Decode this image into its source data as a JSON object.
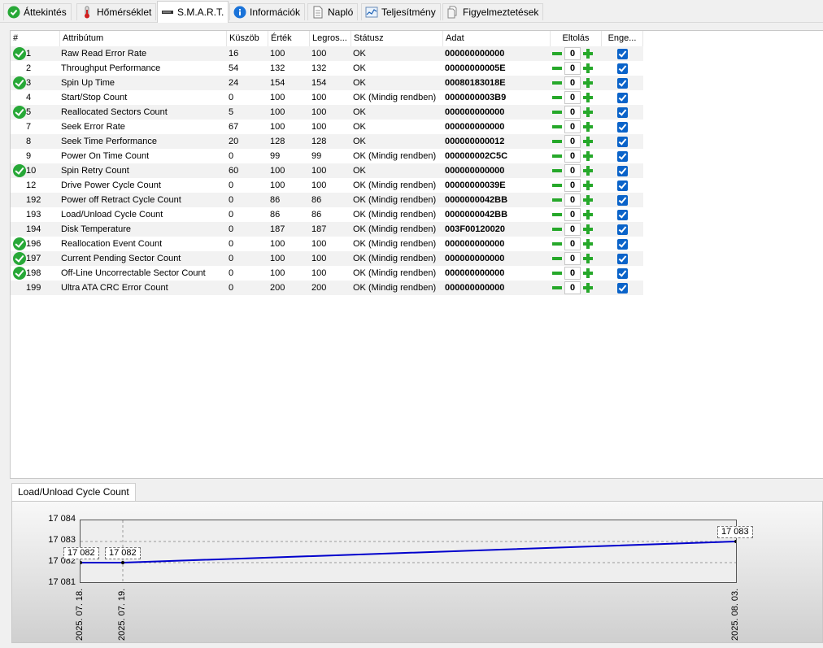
{
  "tabs": [
    {
      "label": "Áttekintés",
      "icon": "check-circle-icon"
    },
    {
      "label": "Hőmérséklet",
      "icon": "thermometer-icon"
    },
    {
      "label": "S.M.A.R.T.",
      "icon": "drive-icon"
    },
    {
      "label": "Információk",
      "icon": "info-icon"
    },
    {
      "label": "Napló",
      "icon": "document-icon"
    },
    {
      "label": "Teljesítmény",
      "icon": "performance-chart-icon"
    },
    {
      "label": "Figyelmeztetések",
      "icon": "warnings-icon"
    }
  ],
  "columns": {
    "id": "#",
    "attr": "Attribútum",
    "thresh": "Küszöb",
    "value": "Érték",
    "worst": "Legros...",
    "status": "Státusz",
    "data": "Adat",
    "offset": "Eltolás",
    "enable": "Enge..."
  },
  "rows": [
    {
      "ok": true,
      "id": "1",
      "attr": "Raw Read Error Rate",
      "thresh": "16",
      "value": "100",
      "worst": "100",
      "status": "OK",
      "data": "000000000000",
      "offset": "0"
    },
    {
      "ok": false,
      "id": "2",
      "attr": "Throughput Performance",
      "thresh": "54",
      "value": "132",
      "worst": "132",
      "status": "OK",
      "data": "00000000005E",
      "offset": "0"
    },
    {
      "ok": true,
      "id": "3",
      "attr": "Spin Up Time",
      "thresh": "24",
      "value": "154",
      "worst": "154",
      "status": "OK",
      "data": "00080183018E",
      "offset": "0"
    },
    {
      "ok": false,
      "id": "4",
      "attr": "Start/Stop Count",
      "thresh": "0",
      "value": "100",
      "worst": "100",
      "status": "OK (Mindig rendben)",
      "data": "0000000003B9",
      "offset": "0"
    },
    {
      "ok": true,
      "id": "5",
      "attr": "Reallocated Sectors Count",
      "thresh": "5",
      "value": "100",
      "worst": "100",
      "status": "OK",
      "data": "000000000000",
      "offset": "0"
    },
    {
      "ok": false,
      "id": "7",
      "attr": "Seek Error Rate",
      "thresh": "67",
      "value": "100",
      "worst": "100",
      "status": "OK",
      "data": "000000000000",
      "offset": "0"
    },
    {
      "ok": false,
      "id": "8",
      "attr": "Seek Time Performance",
      "thresh": "20",
      "value": "128",
      "worst": "128",
      "status": "OK",
      "data": "000000000012",
      "offset": "0"
    },
    {
      "ok": false,
      "id": "9",
      "attr": "Power On Time Count",
      "thresh": "0",
      "value": "99",
      "worst": "99",
      "status": "OK (Mindig rendben)",
      "data": "000000002C5C",
      "offset": "0"
    },
    {
      "ok": true,
      "id": "10",
      "attr": "Spin Retry Count",
      "thresh": "60",
      "value": "100",
      "worst": "100",
      "status": "OK",
      "data": "000000000000",
      "offset": "0"
    },
    {
      "ok": false,
      "id": "12",
      "attr": "Drive Power Cycle Count",
      "thresh": "0",
      "value": "100",
      "worst": "100",
      "status": "OK (Mindig rendben)",
      "data": "00000000039E",
      "offset": "0"
    },
    {
      "ok": false,
      "id": "192",
      "attr": "Power off Retract Cycle Count",
      "thresh": "0",
      "value": "86",
      "worst": "86",
      "status": "OK (Mindig rendben)",
      "data": "0000000042BB",
      "offset": "0"
    },
    {
      "ok": false,
      "id": "193",
      "attr": "Load/Unload Cycle Count",
      "thresh": "0",
      "value": "86",
      "worst": "86",
      "status": "OK (Mindig rendben)",
      "data": "0000000042BB",
      "offset": "0"
    },
    {
      "ok": false,
      "id": "194",
      "attr": "Disk Temperature",
      "thresh": "0",
      "value": "187",
      "worst": "187",
      "status": "OK (Mindig rendben)",
      "data": "003F00120020",
      "offset": "0"
    },
    {
      "ok": true,
      "id": "196",
      "attr": "Reallocation Event Count",
      "thresh": "0",
      "value": "100",
      "worst": "100",
      "status": "OK (Mindig rendben)",
      "data": "000000000000",
      "offset": "0"
    },
    {
      "ok": true,
      "id": "197",
      "attr": "Current Pending Sector Count",
      "thresh": "0",
      "value": "100",
      "worst": "100",
      "status": "OK (Mindig rendben)",
      "data": "000000000000",
      "offset": "0"
    },
    {
      "ok": true,
      "id": "198",
      "attr": "Off-Line Uncorrectable Sector Count",
      "thresh": "0",
      "value": "100",
      "worst": "100",
      "status": "OK (Mindig rendben)",
      "data": "000000000000",
      "offset": "0"
    },
    {
      "ok": false,
      "id": "199",
      "attr": "Ultra ATA CRC Error Count",
      "thresh": "0",
      "value": "200",
      "worst": "200",
      "status": "OK (Mindig rendben)",
      "data": "000000000000",
      "offset": "0"
    }
  ],
  "graph_tab": "Load/Unload Cycle Count",
  "chart_data": {
    "type": "line",
    "title": "",
    "xlabel": "",
    "ylabel": "",
    "x": [
      "2025. 07. 18.",
      "2025. 07. 19.",
      "2025. 08. 03."
    ],
    "y": [
      17082,
      17082,
      17083
    ],
    "point_labels": [
      "17 082",
      "17 082",
      "17 083"
    ],
    "yticks": [
      "17 084",
      "17 083",
      "17 082",
      "17 081"
    ],
    "ylim": [
      17081,
      17084
    ],
    "grid": true,
    "line_color": "#0000cc"
  }
}
